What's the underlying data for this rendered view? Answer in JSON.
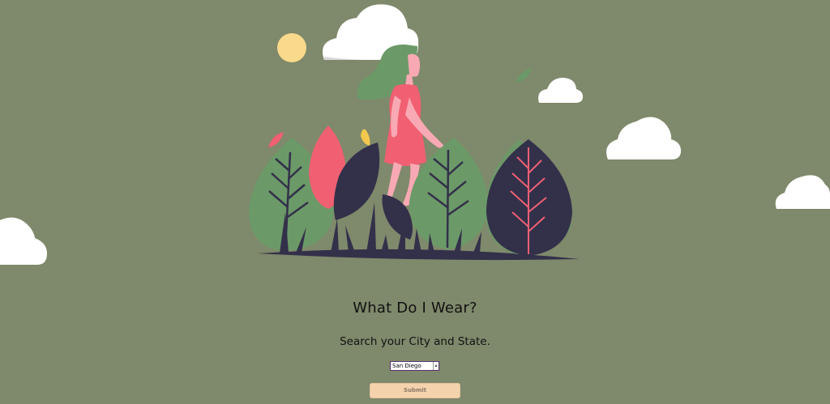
{
  "header": {
    "title": "What Do I Wear?",
    "subtitle": "Search your City and State."
  },
  "search": {
    "value": "San Diego"
  },
  "form": {
    "submit_label": "Submit"
  },
  "colors": {
    "background": "#7f896b",
    "button": "#f3d2ac",
    "leaf_green": "#6b9a68",
    "leaf_dark": "#33304a",
    "leaf_pink": "#f06072",
    "sun": "#f9d98b",
    "cloud": "#ffffff"
  }
}
